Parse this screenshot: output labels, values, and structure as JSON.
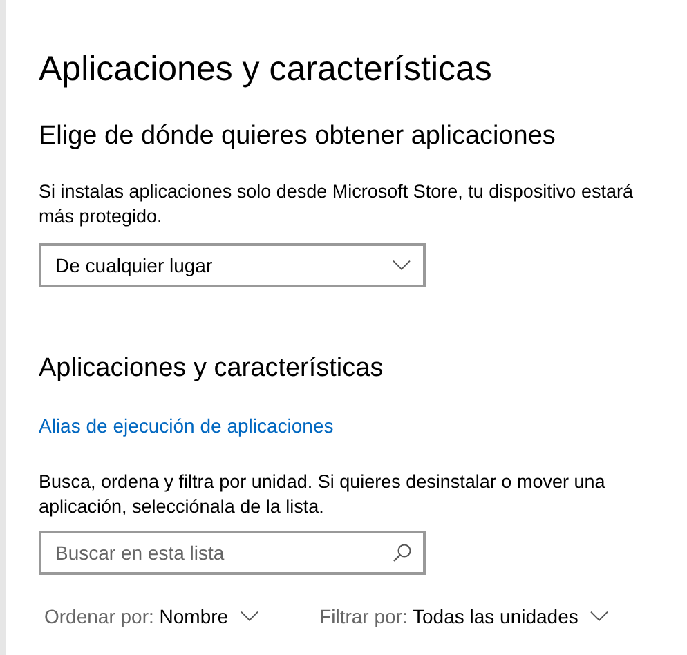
{
  "page": {
    "title": "Aplicaciones y características"
  },
  "source_section": {
    "heading": "Elige de dónde quieres obtener aplicaciones",
    "description": "Si instalas aplicaciones solo desde Microsoft Store, tu dispositivo estará más protegido.",
    "dropdown": {
      "value": "De cualquier lugar"
    }
  },
  "apps_section": {
    "heading": "Aplicaciones y características",
    "link": "Alias de ejecución de aplicaciones",
    "description": "Busca, ordena y filtra por unidad. Si quieres desinstalar o mover una aplicación, selecciónala de la lista.",
    "search": {
      "placeholder": "Buscar en esta lista"
    },
    "filters": [
      {
        "label": "Ordenar por:",
        "value": "Nombre"
      },
      {
        "label": "Filtrar por:",
        "value": "Todas las unidades"
      }
    ]
  }
}
